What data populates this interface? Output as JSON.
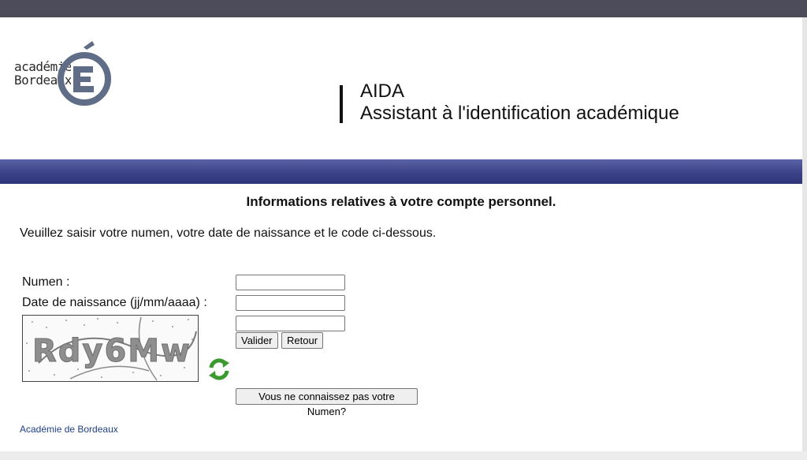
{
  "header": {
    "logo_line1": "académie",
    "logo_line2": "Bordeaux",
    "app_title": "AIDA",
    "app_subtitle": "Assistant à l'identification académique"
  },
  "main": {
    "section_title": "Informations relatives à votre compte personnel.",
    "instructions": "Veuillez saisir votre numen, votre date de naissance et le code ci-dessous.",
    "form": {
      "numen_label": "Numen :",
      "birthdate_label": "Date de naissance (jj/mm/aaaa) :",
      "numen_value": "",
      "birthdate_value": "",
      "captcha_value": "",
      "captcha_text": "Rdy6Mw",
      "validate_label": "Valider",
      "back_label": "Retour",
      "forgot_numen_label": "Vous ne connaissez pas votre Numen?"
    }
  },
  "footer": {
    "link_label": "Académie de Bordeaux"
  },
  "colors": {
    "topbar": "#4d4c5a",
    "band": "#3c4389",
    "link": "#1e3f8a",
    "refresh_green": "#3a9a2e"
  },
  "icons": {
    "logo": "academie-e-logo-icon",
    "refresh": "refresh-captcha-icon"
  }
}
